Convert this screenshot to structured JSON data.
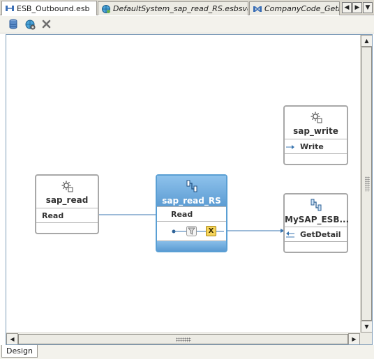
{
  "tabs": [
    {
      "label": "ESB_Outbound.esb",
      "icon": "esb-diagram-icon",
      "italic": false,
      "active": true
    },
    {
      "label": "DefaultSystem_sap_read_RS.esbsvc",
      "icon": "globe-service-icon",
      "italic": true,
      "active": false
    },
    {
      "label": "CompanyCode_GetDe",
      "icon": "esb-diagram-icon",
      "italic": true,
      "active": false
    }
  ],
  "tab_navigation": {
    "left_glyph": "◀",
    "right_glyph": "▶",
    "menu_glyph": "▼"
  },
  "toolbar": {
    "buttons": [
      {
        "name": "database-icon"
      },
      {
        "name": "globe-gear-icon"
      },
      {
        "name": "delete-icon"
      }
    ]
  },
  "nodes": [
    {
      "id": "sap_read",
      "title": "sap_read",
      "icon": "gear-icon",
      "operation": "Read",
      "selected": false
    },
    {
      "id": "sap_read_RS",
      "title": "sap_read_RS",
      "icon": "routing-service-icon",
      "operation": "Read",
      "selected": true
    },
    {
      "id": "sap_write",
      "title": "sap_write",
      "icon": "gear-icon",
      "operation": "Write",
      "selected": false
    },
    {
      "id": "MySAP_ESB",
      "title": "MySAP_ESB...",
      "icon": "routing-service-icon",
      "operation": "GetDetail",
      "selected": false
    }
  ],
  "routing_rule": {
    "filter_icon": "filter-icon",
    "transform_label": "X",
    "transform_icon": "transform-icon"
  },
  "scrollbars": {
    "up_glyph": "▲",
    "down_glyph": "▼",
    "left_glyph": "◀",
    "right_glyph": "▶"
  },
  "bottom_tabs": [
    {
      "label": "Design",
      "active": true
    }
  ],
  "colors": {
    "selected_header": "#6aa8dc",
    "wire": "#3a76b0",
    "node_border": "#a8a8a8",
    "transform_badge": "#f6d55c"
  }
}
